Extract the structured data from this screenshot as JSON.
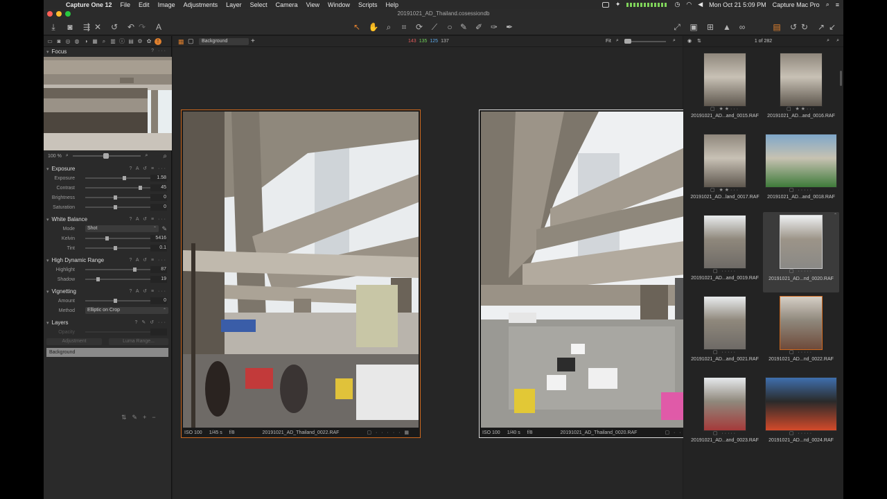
{
  "menubar": {
    "app_name": "Capture One 12",
    "items": [
      "File",
      "Edit",
      "Image",
      "Adjustments",
      "Layer",
      "Select",
      "Camera",
      "View",
      "Window",
      "Scripts",
      "Help"
    ],
    "clock": "Mon Oct 21  5:09 PM",
    "right_app": "Capture Mac Pro"
  },
  "window": {
    "title": "20191021_AD_Thailand.cosessiondb"
  },
  "colors": {
    "accent": "#e0802e",
    "selected_border": "#c9c9c9",
    "red": "#e05a5a",
    "green": "#6fcf5a",
    "blue": "#5ca8e8"
  },
  "left_panel": {
    "focus": {
      "title": "Focus",
      "help": "?",
      "zoom": "100 %"
    },
    "exposure": {
      "title": "Exposure",
      "rows": [
        {
          "label": "Exposure",
          "value": "1.58",
          "pos": 0.6
        },
        {
          "label": "Contrast",
          "value": "45",
          "pos": 0.85
        },
        {
          "label": "Brightness",
          "value": "0",
          "pos": 0.45
        },
        {
          "label": "Saturation",
          "value": "0",
          "pos": 0.45
        }
      ]
    },
    "white_balance": {
      "title": "White Balance",
      "mode_label": "Mode",
      "mode_value": "Shot",
      "kelvin_label": "Kelvin",
      "kelvin_value": "5416",
      "kelvin_pos": 0.32,
      "tint_label": "Tint",
      "tint_value": "0.1",
      "tint_pos": 0.45
    },
    "hdr": {
      "title": "High Dynamic Range",
      "highlight_label": "Highlight",
      "highlight_value": "87",
      "highlight_pos": 0.77,
      "shadow_label": "Shadow",
      "shadow_value": "19",
      "shadow_pos": 0.18
    },
    "vignetting": {
      "title": "Vignetting",
      "amount_label": "Amount",
      "amount_value": "0",
      "amount_pos": 0.45,
      "method_label": "Method",
      "method_value": "Elliptic on Crop"
    },
    "layers": {
      "title": "Layers",
      "opacity_label": "Opacity",
      "adjustment_label": "Adjustment",
      "luma_label": "Luma Range...",
      "background": "Background"
    }
  },
  "viewer": {
    "layer_select": "Background",
    "rgb": {
      "r": "143",
      "g": "135",
      "b": "125",
      "a": "137"
    },
    "fit": "Fit",
    "photos": [
      {
        "iso": "ISO 100",
        "shutter": "1/45 s",
        "aperture": "f/8",
        "filename": "20191021_AD_Thailand_0022.RAF"
      },
      {
        "iso": "ISO 100",
        "shutter": "1/40 s",
        "aperture": "f/8",
        "filename": "20191021_AD_Thailand_0020.RAF"
      }
    ]
  },
  "browser": {
    "count": "1 of 282",
    "thumbs": [
      {
        "name": "20191021_AD...and_0015.RAF",
        "stars": "★★···"
      },
      {
        "name": "20191021_AD...and_0016.RAF",
        "stars": "★★···"
      },
      {
        "name": "20191021_AD...land_0017.RAF",
        "stars": "★★···"
      },
      {
        "name": "20191021_AD...and_0018.RAF",
        "stars": "·····"
      },
      {
        "name": "20191021_AD...and_0019.RAF",
        "stars": "·····"
      },
      {
        "name": "20191021_AD...nd_0020.RAF",
        "stars": "·····"
      },
      {
        "name": "20191021_AD...and_0021.RAF",
        "stars": "·····"
      },
      {
        "name": "20191021_AD...nd_0022.RAF",
        "stars": "·····"
      },
      {
        "name": "20191021_AD...and_0023.RAF",
        "stars": "·····"
      },
      {
        "name": "20191021_AD...nd_0024.RAF",
        "stars": "·····"
      }
    ]
  }
}
